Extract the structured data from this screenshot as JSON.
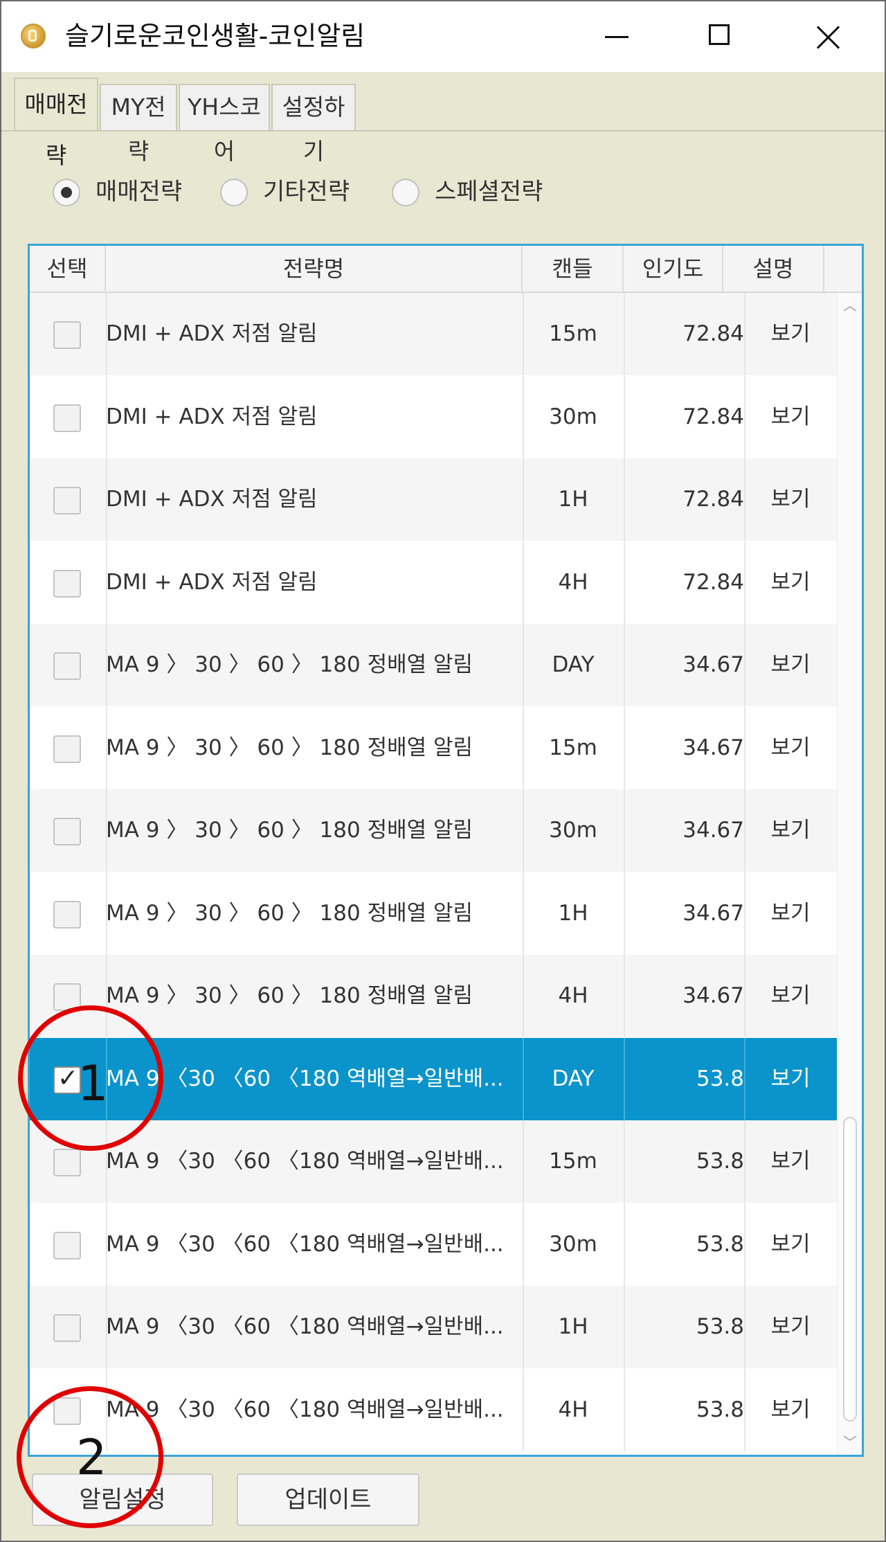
{
  "window": {
    "title": "슬기로운코인생활-코인알림",
    "controls": {
      "minimize": "minimize-icon",
      "maximize": "maximize-icon",
      "close": "close-icon"
    }
  },
  "tabs": [
    {
      "label": "매매전략",
      "active": true
    },
    {
      "label": "MY전략",
      "active": false
    },
    {
      "label": "YH스코어",
      "active": false
    },
    {
      "label": "설정하기",
      "active": false
    }
  ],
  "strategy_types": [
    {
      "label": "매매전략",
      "checked": true
    },
    {
      "label": "기타전략",
      "checked": false
    },
    {
      "label": "스페셜전략",
      "checked": false
    }
  ],
  "grid": {
    "columns": {
      "select": "선택",
      "name": "전략명",
      "candle": "캔들",
      "popularity": "인기도",
      "description": "설명"
    },
    "rows": [
      {
        "checked": false,
        "name": "DMI + ADX 저점 알림",
        "candle": "15m",
        "popularity": "72.84",
        "desc": "보기"
      },
      {
        "checked": false,
        "name": "DMI + ADX 저점 알림",
        "candle": "30m",
        "popularity": "72.84",
        "desc": "보기"
      },
      {
        "checked": false,
        "name": "DMI + ADX 저점 알림",
        "candle": "1H",
        "popularity": "72.84",
        "desc": "보기"
      },
      {
        "checked": false,
        "name": "DMI + ADX 저점 알림",
        "candle": "4H",
        "popularity": "72.84",
        "desc": "보기"
      },
      {
        "checked": false,
        "name": "MA 9 〉 30 〉 60 〉 180 정배열 알림",
        "candle": "DAY",
        "popularity": "34.67",
        "desc": "보기"
      },
      {
        "checked": false,
        "name": "MA 9 〉 30 〉 60 〉 180 정배열 알림",
        "candle": "15m",
        "popularity": "34.67",
        "desc": "보기"
      },
      {
        "checked": false,
        "name": "MA 9 〉 30 〉 60 〉 180 정배열 알림",
        "candle": "30m",
        "popularity": "34.67",
        "desc": "보기"
      },
      {
        "checked": false,
        "name": "MA 9 〉 30 〉 60 〉 180 정배열 알림",
        "candle": "1H",
        "popularity": "34.67",
        "desc": "보기"
      },
      {
        "checked": false,
        "name": "MA 9 〉 30 〉 60 〉 180 정배열 알림",
        "candle": "4H",
        "popularity": "34.67",
        "desc": "보기"
      },
      {
        "checked": true,
        "selected": true,
        "name": "MA 9 〈30 〈60 〈180 역배열→일반배...",
        "candle": "DAY",
        "popularity": "53.8",
        "desc": "보기"
      },
      {
        "checked": false,
        "name": "MA 9 〈30 〈60 〈180 역배열→일반배...",
        "candle": "15m",
        "popularity": "53.8",
        "desc": "보기"
      },
      {
        "checked": false,
        "name": "MA 9 〈30 〈60 〈180 역배열→일반배...",
        "candle": "30m",
        "popularity": "53.8",
        "desc": "보기"
      },
      {
        "checked": false,
        "name": "MA 9 〈30 〈60 〈180 역배열→일반배...",
        "candle": "1H",
        "popularity": "53.8",
        "desc": "보기"
      },
      {
        "checked": false,
        "name": "MA 9 〈30 〈60 〈180 역배열→일반배...",
        "candle": "4H",
        "popularity": "53.8",
        "desc": "보기"
      }
    ]
  },
  "buttons": {
    "alert_settings": "알림설정",
    "update": "업데이트"
  },
  "annotations": [
    {
      "label": "1"
    },
    {
      "label": "2"
    }
  ],
  "colors": {
    "selection": "#0a94cb",
    "grid_border": "#3ba4d8",
    "annotation": "#e00000",
    "window_bg": "#e8e8d2"
  }
}
